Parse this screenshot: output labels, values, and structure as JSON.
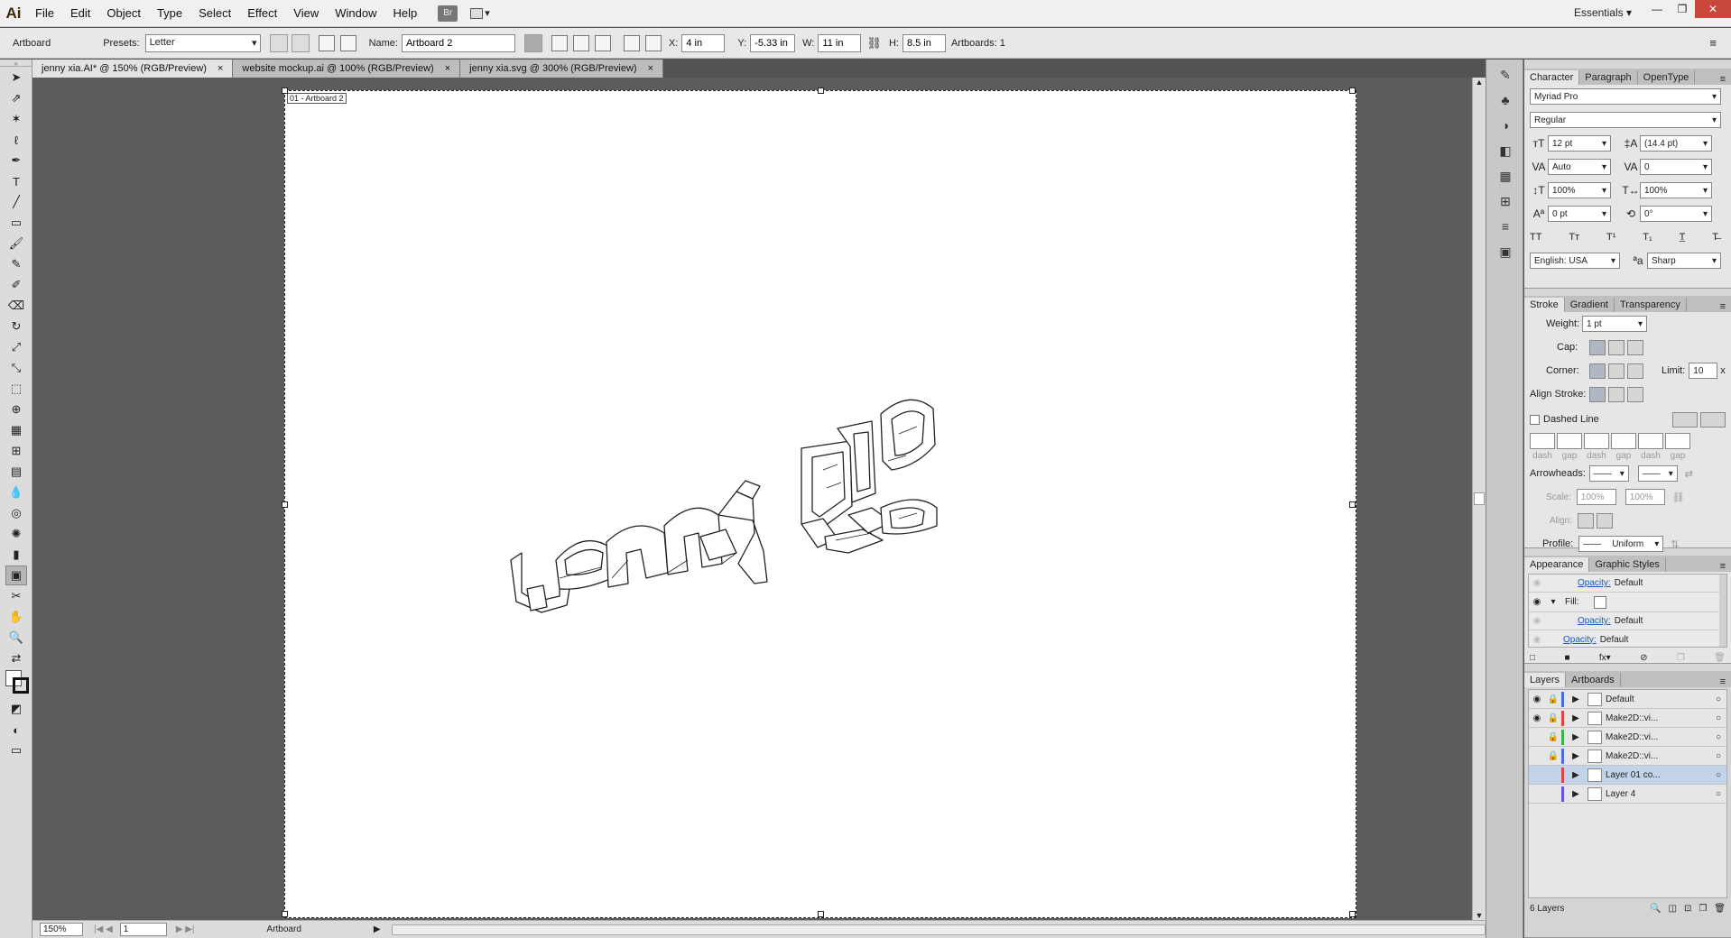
{
  "app": {
    "logo": "Ai",
    "menu": [
      "File",
      "Edit",
      "Object",
      "Type",
      "Select",
      "Effect",
      "View",
      "Window",
      "Help"
    ],
    "bridge": "Br",
    "workspace": "Essentials"
  },
  "control": {
    "tool_label": "Artboard",
    "presets_label": "Presets:",
    "preset_value": "Letter",
    "name_label": "Name:",
    "name_value": "Artboard 2",
    "x_label": "X:",
    "x_value": "4 in",
    "y_label": "Y:",
    "y_value": "-5.33 in",
    "w_label": "W:",
    "w_value": "11 in",
    "h_label": "H:",
    "h_value": "8.5 in",
    "artboards_label": "Artboards: 1"
  },
  "tabs": [
    {
      "label": "jenny xia.AI* @ 150% (RGB/Preview)"
    },
    {
      "label": "website mockup.ai @ 100% (RGB/Preview)"
    },
    {
      "label": "jenny xia.svg @ 300% (RGB/Preview)"
    }
  ],
  "canvas": {
    "artboard_label": "01 - Artboard 2"
  },
  "status": {
    "zoom": "150%",
    "page": "1",
    "tool": "Artboard"
  },
  "character": {
    "tabs": [
      "Character",
      "Paragraph",
      "OpenType"
    ],
    "font": "Myriad Pro",
    "style": "Regular",
    "size": "12 pt",
    "leading": "(14.4 pt)",
    "kerning": "Auto",
    "tracking": "0",
    "vscale": "100%",
    "hscale": "100%",
    "baseline": "0 pt",
    "rotation": "0°",
    "language": "English: USA",
    "aa_label": "ªa",
    "antialias": "Sharp"
  },
  "stroke": {
    "tabs": [
      "Stroke",
      "Gradient",
      "Transparency"
    ],
    "weight_label": "Weight:",
    "weight": "1 pt",
    "cap_label": "Cap:",
    "corner_label": "Corner:",
    "limit_label": "Limit:",
    "limit": "10",
    "limit_unit": "x",
    "align_label": "Align Stroke:",
    "dashed_label": "Dashed Line",
    "dash_labels": [
      "dash",
      "gap",
      "dash",
      "gap",
      "dash",
      "gap"
    ],
    "arrowheads_label": "Arrowheads:",
    "scale_label": "Scale:",
    "scale1": "100%",
    "scale2": "100%",
    "align2_label": "Align:",
    "profile_label": "Profile:",
    "profile": "Uniform"
  },
  "appearance": {
    "tabs": [
      "Appearance",
      "Graphic Styles"
    ],
    "rows": [
      {
        "label": "Opacity:",
        "value": "Default"
      },
      {
        "label": "Fill:",
        "value": ""
      },
      {
        "label": "Opacity:",
        "value": "Default"
      },
      {
        "label": "Opacity:",
        "value": "Default"
      }
    ]
  },
  "layers": {
    "tabs": [
      "Layers",
      "Artboards"
    ],
    "items": [
      {
        "name": "Default",
        "color": "#4d6fd6"
      },
      {
        "name": "Make2D::vi...",
        "color": "#d84848"
      },
      {
        "name": "Make2D::vi...",
        "color": "#3fb04f"
      },
      {
        "name": "Make2D::vi...",
        "color": "#4d6fd6"
      },
      {
        "name": "Layer 01 co...",
        "color": "#d84848"
      },
      {
        "name": "Layer 4",
        "color": "#6a54d8"
      }
    ],
    "count": "6 Layers"
  }
}
